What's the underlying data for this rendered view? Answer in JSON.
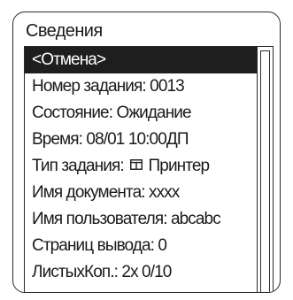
{
  "panel": {
    "title": "Сведения"
  },
  "list": {
    "cancel": "<Отмена>",
    "job_number": "Номер задания: 0013",
    "status": "Состояние: Ожидание",
    "time": "Время: 08/01 10:00ДП",
    "job_type_label": "Тип задания:",
    "job_type_icon": "document-icon",
    "job_type_value": "Принтер",
    "document_name": "Имя документа: xxxx",
    "user_name": "Имя пользователя: abcabc",
    "pages_output": "Страниц вывода:  0",
    "sheets_copies": "ЛистыхКоп.: 2x 0/10"
  },
  "colors": {
    "selection_background": "#1e1e1e",
    "selection_text": "#ffffff",
    "border": "#2a2a2a"
  }
}
